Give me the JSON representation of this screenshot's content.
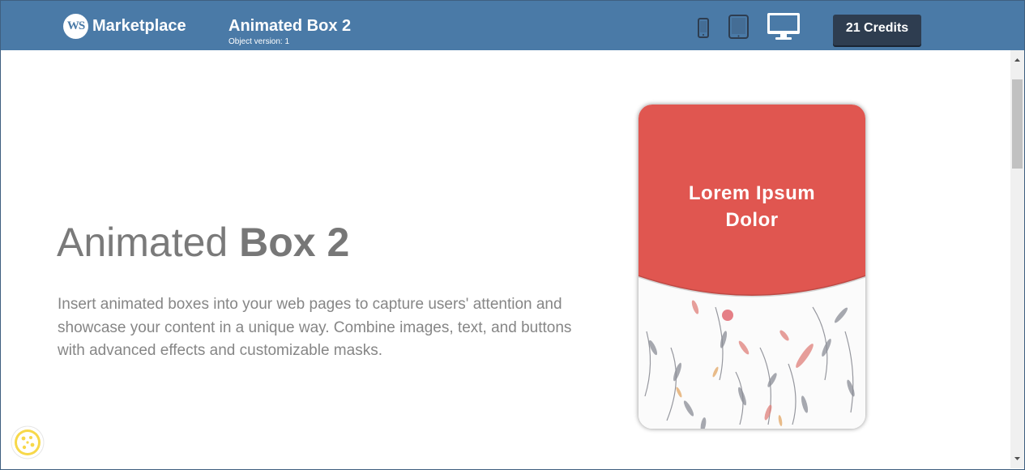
{
  "header": {
    "brand": "Marketplace",
    "logo_text": "WS",
    "title": "Animated Box 2",
    "subtitle": "Object version: 1",
    "credits_label": "21 Credits",
    "bar_color": "#4a7aa7",
    "devices": [
      "mobile-icon",
      "tablet-icon",
      "desktop-icon"
    ]
  },
  "hero": {
    "title_light": "Animated ",
    "title_bold": "Box 2",
    "description": "Insert animated boxes into your web pages to capture users' attention and showcase your content in a unique way. Combine images, text, and buttons with advanced effects and customizable masks."
  },
  "preview_card": {
    "text_line1": "Lorem Ipsum",
    "text_line2": "Dolor",
    "mask_color": "#e05650"
  },
  "icons": {
    "cookie": "cookie-icon"
  }
}
